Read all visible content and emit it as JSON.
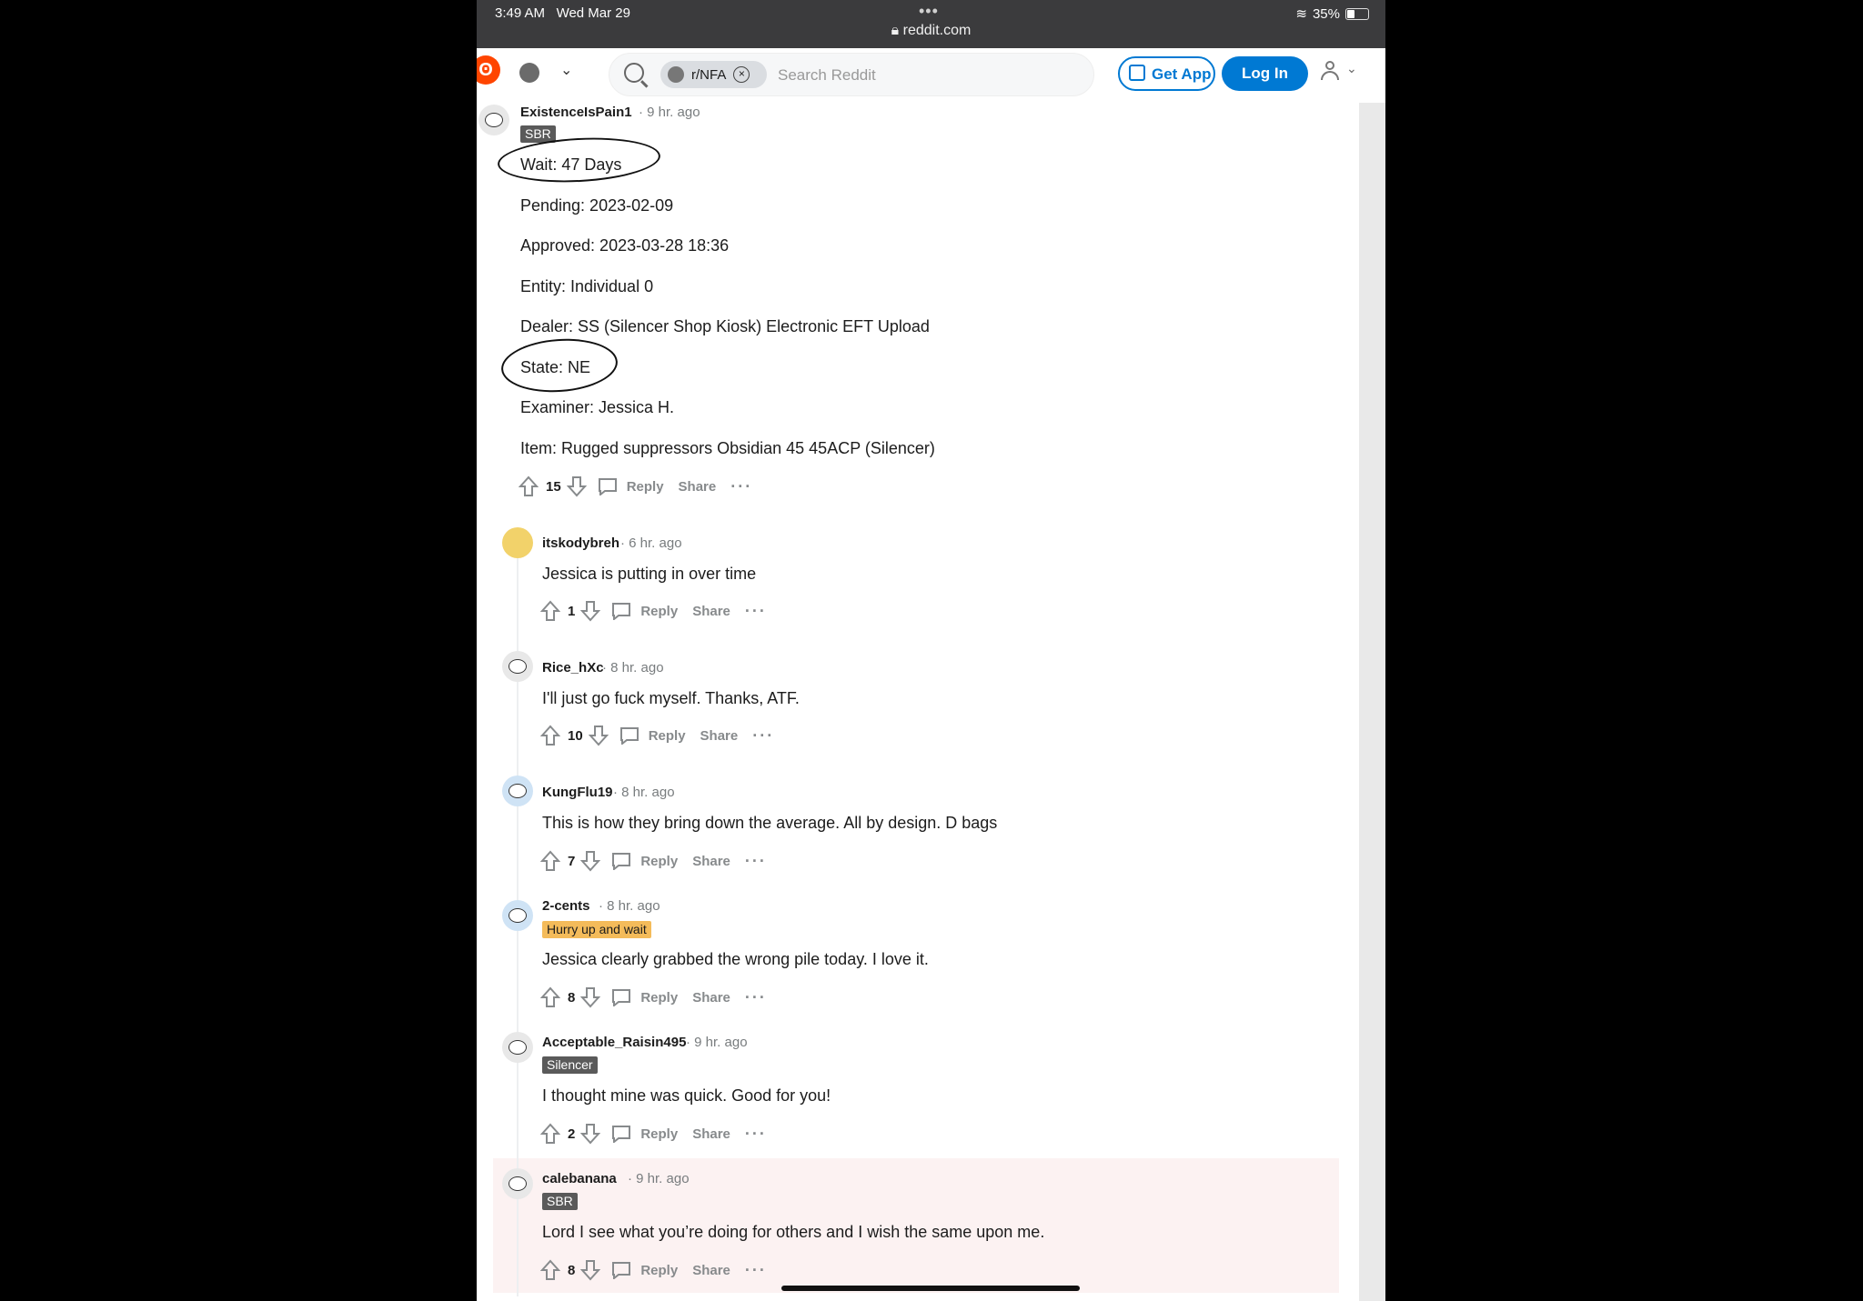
{
  "status_bar": {
    "time": "3:49 AM",
    "date": "Wed Mar 29",
    "url": "reddit.com",
    "battery": "35%"
  },
  "header": {
    "subreddit_chip": "r/NFA",
    "search_placeholder": "Search Reddit",
    "get_app_label": "Get App",
    "login_label": "Log In"
  },
  "actions_labels": {
    "reply": "Reply",
    "share": "Share",
    "more": "···"
  },
  "comments": [
    {
      "user": "ExistenceIsPain1",
      "time": "· 9 hr. ago",
      "flair": "SBR",
      "lines": [
        "Wait: 47 Days",
        "Pending: 2023-02-09",
        "Approved: 2023-03-28 18:36",
        "Entity: Individual 0",
        "Dealer: SS (Silencer Shop Kiosk) Electronic EFT Upload",
        "State: NE",
        "Examiner: Jessica H.",
        "Item: Rugged suppressors Obsidian 45 45ACP (Silencer)"
      ],
      "score": "15"
    },
    {
      "user": "itskodybreh",
      "time": "· 6 hr. ago",
      "text": "Jessica is putting in over time",
      "score": "1"
    },
    {
      "user": "Rice_hXc",
      "time": "· 8 hr. ago",
      "text": "I'll just go fuck myself. Thanks, ATF.",
      "score": "10"
    },
    {
      "user": "KungFlu19",
      "time": "· 8 hr. ago",
      "text": "This is how they bring down the average. All by design. D bags",
      "score": "7"
    },
    {
      "user": "2-cents",
      "time": "· 8 hr. ago",
      "flair": "Hurry up and wait",
      "text": "Jessica clearly grabbed the wrong pile today. I love it.",
      "score": "8"
    },
    {
      "user": "Acceptable_Raisin495",
      "time": "· 9 hr. ago",
      "flair": "Silencer",
      "text": "I thought mine was quick. Good for you!",
      "score": "2"
    },
    {
      "user": "calebanana",
      "time": "· 9 hr. ago",
      "flair": "SBR",
      "text": "Lord I see what you’re doing for others and I wish the same upon me.",
      "score": "8"
    }
  ],
  "colors": {
    "accent": "#0079d3",
    "brand": "#ff4500",
    "flair_dark": "#5a5a5a",
    "flair_orange": "#f4bb5a",
    "highlight": "#fcf2f2"
  },
  "icons": [
    "reddit-logo-icon",
    "search-icon",
    "close-circle-icon",
    "qr-code-icon",
    "user-icon",
    "chevron-down-icon",
    "upvote-icon",
    "downvote-icon",
    "comment-icon",
    "more-icon"
  ]
}
